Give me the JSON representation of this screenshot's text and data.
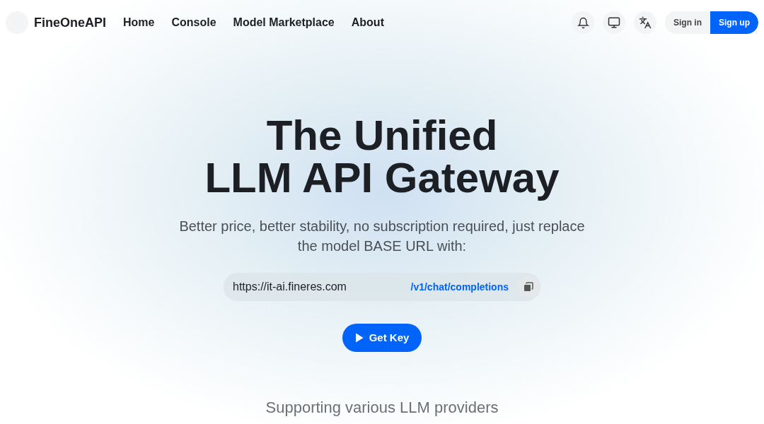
{
  "brand": "FineOneAPI",
  "nav": [
    {
      "label": "Home"
    },
    {
      "label": "Console"
    },
    {
      "label": "Model Marketplace"
    },
    {
      "label": "About"
    }
  ],
  "auth": {
    "sign_in": "Sign in",
    "sign_up": "Sign up"
  },
  "hero": {
    "title_lines": [
      "The Unified",
      "LLM API Gateway"
    ],
    "subtitle": "Better price, better stability, no subscription required, just replace the model BASE URL with:",
    "base_url": "https://it-ai.fineres.com",
    "endpoint": "/v1/chat/completions",
    "cta": "Get Key"
  },
  "providers_heading": "Supporting various LLM providers"
}
